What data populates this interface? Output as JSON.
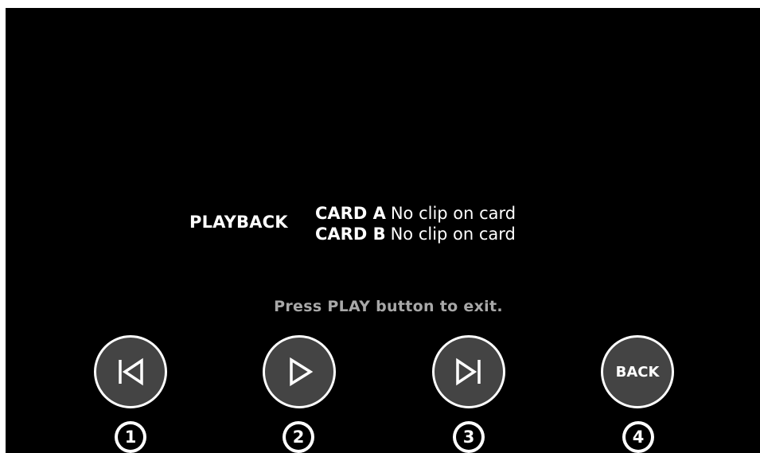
{
  "playback": {
    "title": "PLAYBACK",
    "cards": [
      {
        "name": "CARD A",
        "status": "No clip on card"
      },
      {
        "name": "CARD B",
        "status": "No clip on card"
      }
    ]
  },
  "message": "Press PLAY button to exit.",
  "controls": [
    {
      "icon": "skip-previous-icon",
      "number": "1"
    },
    {
      "icon": "play-icon",
      "number": "2"
    },
    {
      "icon": "skip-next-icon",
      "number": "3"
    },
    {
      "label": "BACK",
      "number": "4"
    }
  ],
  "colors": {
    "background": "#000000",
    "button_fill": "#444444",
    "text": "#ffffff",
    "message": "#a8a8a8"
  }
}
